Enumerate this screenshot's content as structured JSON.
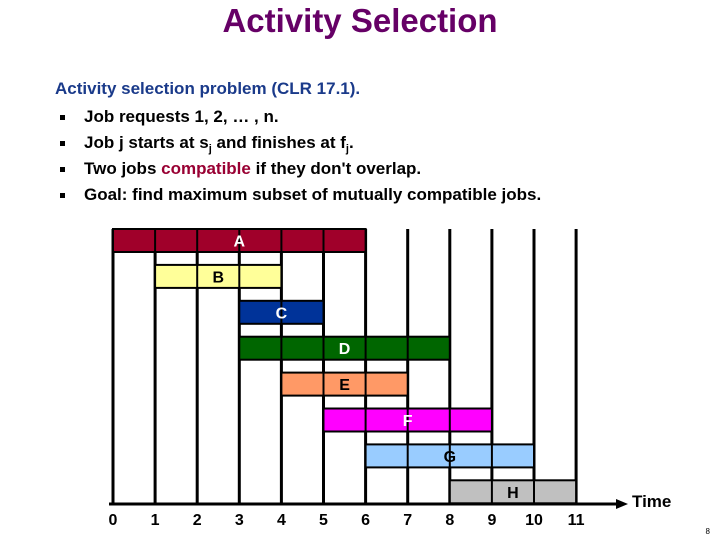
{
  "slide": {
    "title": "Activity Selection",
    "lead": "Activity selection problem (CLR 17.1).",
    "bullets": [
      {
        "parts": [
          "Job requests 1, 2, … , n."
        ]
      },
      {
        "pre": "Job j starts at s",
        "sub1": "j",
        "mid": " and finishes at f",
        "sub2": "j",
        "post": "."
      },
      {
        "pre": "Two jobs ",
        "highlight": "compatible",
        "post": " if they don't overlap."
      },
      {
        "parts": [
          "Goal: find maximum subset of mutually compatible jobs."
        ]
      }
    ],
    "page_number": "8",
    "colors": {
      "title": "#660066",
      "lead": "#1a3a8a",
      "highlight": "#990033"
    }
  },
  "chart_data": {
    "type": "gantt",
    "title": "",
    "xlabel": "Time",
    "ylabel": "",
    "xlim": [
      0,
      11
    ],
    "x_ticks": [
      0,
      1,
      2,
      3,
      4,
      5,
      6,
      7,
      8,
      9,
      10,
      11
    ],
    "grid": true,
    "jobs": [
      {
        "name": "A",
        "start": 0,
        "finish": 6,
        "color": "#a0002a",
        "label_color": "#ffffff"
      },
      {
        "name": "B",
        "start": 1,
        "finish": 4,
        "color": "#ffff99",
        "label_color": "#000000"
      },
      {
        "name": "C",
        "start": 3,
        "finish": 5,
        "color": "#003399",
        "label_color": "#ffffff"
      },
      {
        "name": "D",
        "start": 3,
        "finish": 8,
        "color": "#006600",
        "label_color": "#ffffff"
      },
      {
        "name": "E",
        "start": 4,
        "finish": 7,
        "color": "#ff9966",
        "label_color": "#000000"
      },
      {
        "name": "F",
        "start": 5,
        "finish": 9,
        "color": "#ff00ff",
        "label_color": "#ffffff"
      },
      {
        "name": "G",
        "start": 6,
        "finish": 10,
        "color": "#99ccff",
        "label_color": "#000000"
      },
      {
        "name": "H",
        "start": 8,
        "finish": 11,
        "color": "#c0c0c0",
        "label_color": "#000000"
      }
    ]
  }
}
